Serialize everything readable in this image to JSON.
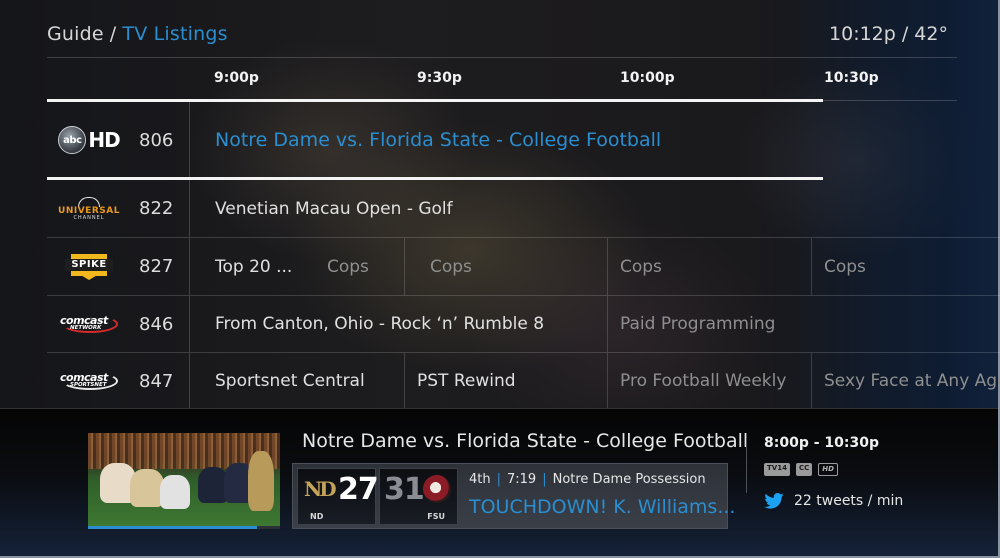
{
  "header": {
    "breadcrumb_root": "Guide",
    "breadcrumb_separator": "/",
    "breadcrumb_current": "TV Listings",
    "clock": "10:12p / 42°"
  },
  "timeline": [
    "9:00p",
    "9:30p",
    "10:00p",
    "10:30p"
  ],
  "channels": [
    {
      "logo": "abc-hd-logo",
      "logo_text": "abc",
      "logo_suffix": "HD",
      "number": "806",
      "selected": true,
      "programs": [
        {
          "title": "Notre Dame vs. Florida State - College Football",
          "state": "selected"
        }
      ]
    },
    {
      "logo": "universal-channel-logo",
      "logo_text": "UNIVERSAL",
      "logo_sub": "CHANNEL",
      "number": "822",
      "programs": [
        {
          "title": "Venetian Macau Open - Golf",
          "state": "normal"
        }
      ]
    },
    {
      "logo": "spike-logo",
      "logo_text": "SPIKE",
      "number": "827",
      "programs": [
        {
          "title": "Top 20 ...",
          "state": "normal"
        },
        {
          "title": "Cops",
          "state": "dim"
        },
        {
          "title": "Cops",
          "state": "dim"
        },
        {
          "title": "Cops",
          "state": "dim"
        },
        {
          "title": "Cops",
          "state": "dim"
        }
      ]
    },
    {
      "logo": "comcast-network-logo",
      "logo_text": "comcast",
      "logo_sub": "NETWORK",
      "number": "846",
      "programs": [
        {
          "title": "From Canton, Ohio - Rock ‘n’ Rumble 8",
          "state": "normal"
        },
        {
          "title": "Paid Programming",
          "state": "dim"
        }
      ]
    },
    {
      "logo": "comcast-sportsnet-logo",
      "logo_text": "comcast",
      "logo_sub": "SPORTSNET",
      "number": "847",
      "programs": [
        {
          "title": "Sportsnet Central",
          "state": "normal"
        },
        {
          "title": "PST Rewind",
          "state": "normal"
        },
        {
          "title": "Pro Football Weekly",
          "state": "dim"
        },
        {
          "title": "Sexy Face at Any Age",
          "state": "dim"
        }
      ]
    }
  ],
  "details": {
    "title": "Notre Dame vs. Florida State - College Football",
    "watch_progress": 0.88,
    "home_team": {
      "abbr": "ND",
      "score": "27",
      "logo_text": "ND"
    },
    "away_team": {
      "abbr": "FSU",
      "score": "31"
    },
    "quarter": "4th",
    "game_clock": "7:19",
    "possession": "Notre Dame Possession",
    "status_separator": "|",
    "event": "TOUCHDOWN! K. Williams...",
    "airtime": "8:00p - 10:30p",
    "badges": [
      "TV14",
      "CC",
      "HD"
    ],
    "tweets": "22 tweets / min"
  },
  "colors": {
    "accent": "#2a8ed0",
    "twitter": "#1da1f2",
    "selection_line": "#f3f3f3"
  }
}
